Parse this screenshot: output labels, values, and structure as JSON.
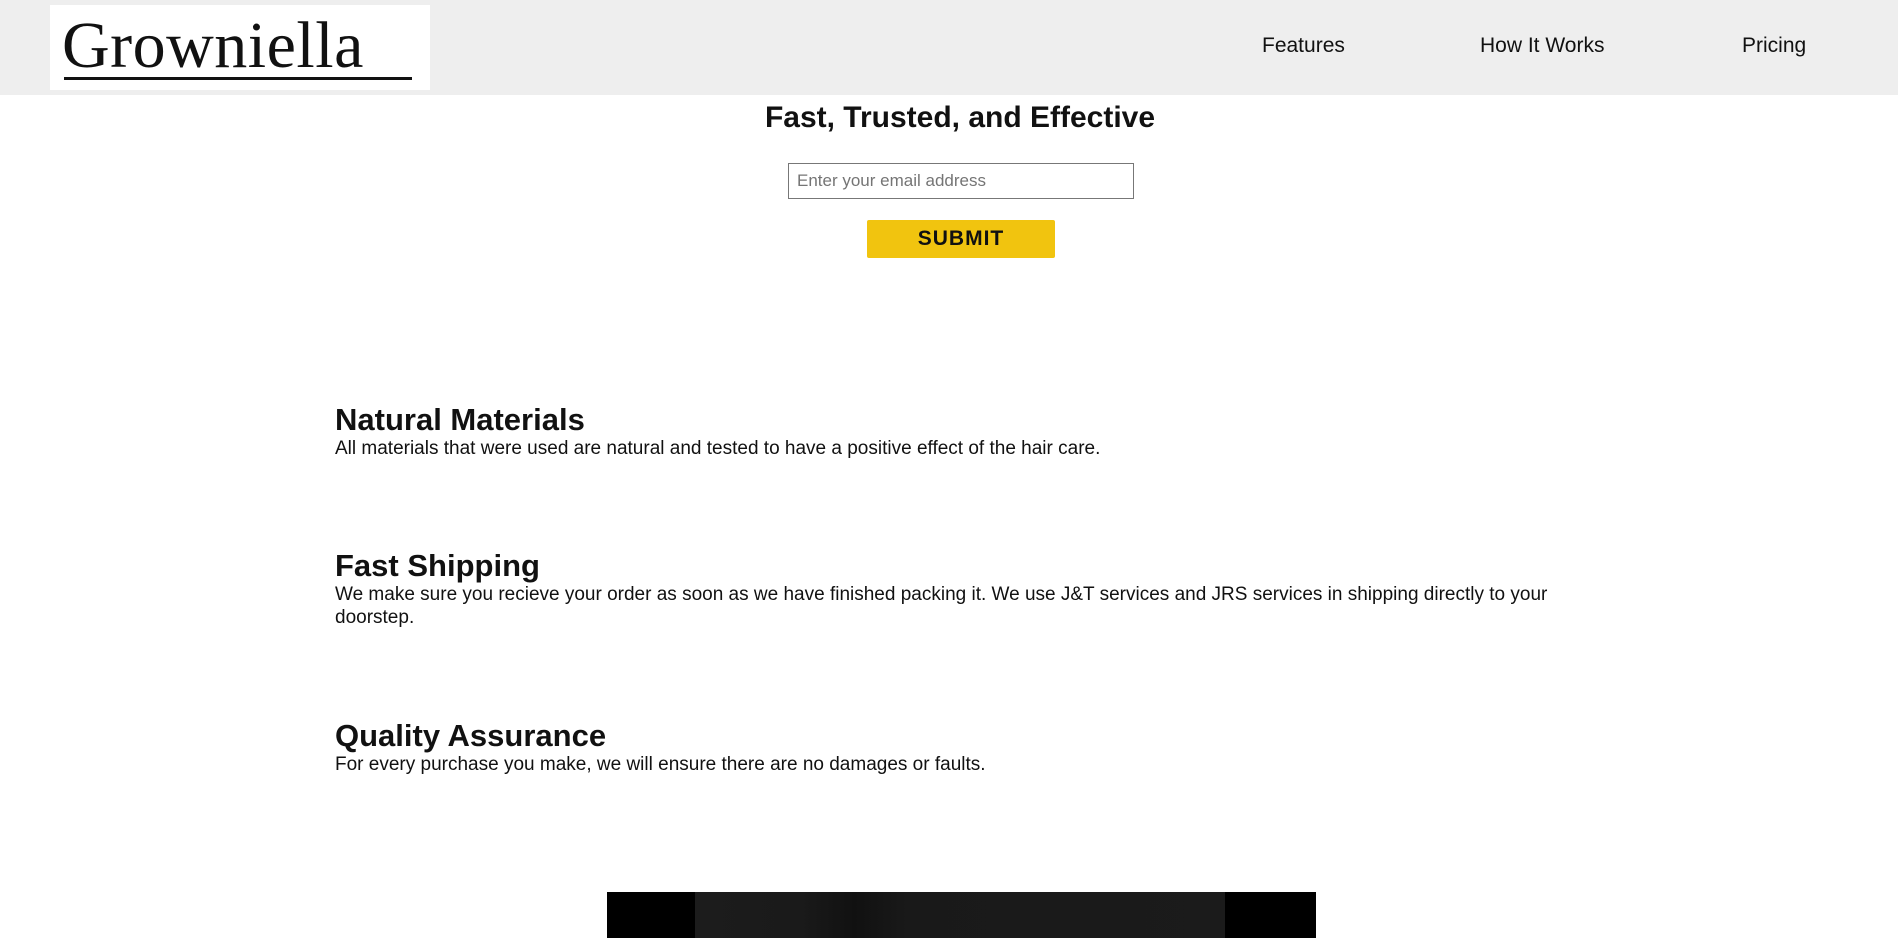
{
  "brand": {
    "logo_text": "Growniella"
  },
  "nav": {
    "items": [
      {
        "label": "Features"
      },
      {
        "label": "How It Works"
      },
      {
        "label": "Pricing"
      }
    ]
  },
  "hero": {
    "title": "Fast, Trusted, and Effective",
    "email_placeholder": "Enter your email address",
    "submit_label": "SUBMIT"
  },
  "features": [
    {
      "title": "Natural Materials",
      "description": "All materials that were used are natural and tested to have a positive effect of the hair care."
    },
    {
      "title": "Fast Shipping",
      "description": "We make sure you recieve your order as soon as we have finished packing it. We use J&T services and JRS services in shipping directly to your doorstep."
    },
    {
      "title": "Quality Assurance",
      "description": "For every purchase you make, we will ensure there are no damages or faults."
    }
  ],
  "colors": {
    "header_bg": "#eeeeee",
    "submit_bg": "#f1c40f",
    "video_bg": "#000000"
  }
}
